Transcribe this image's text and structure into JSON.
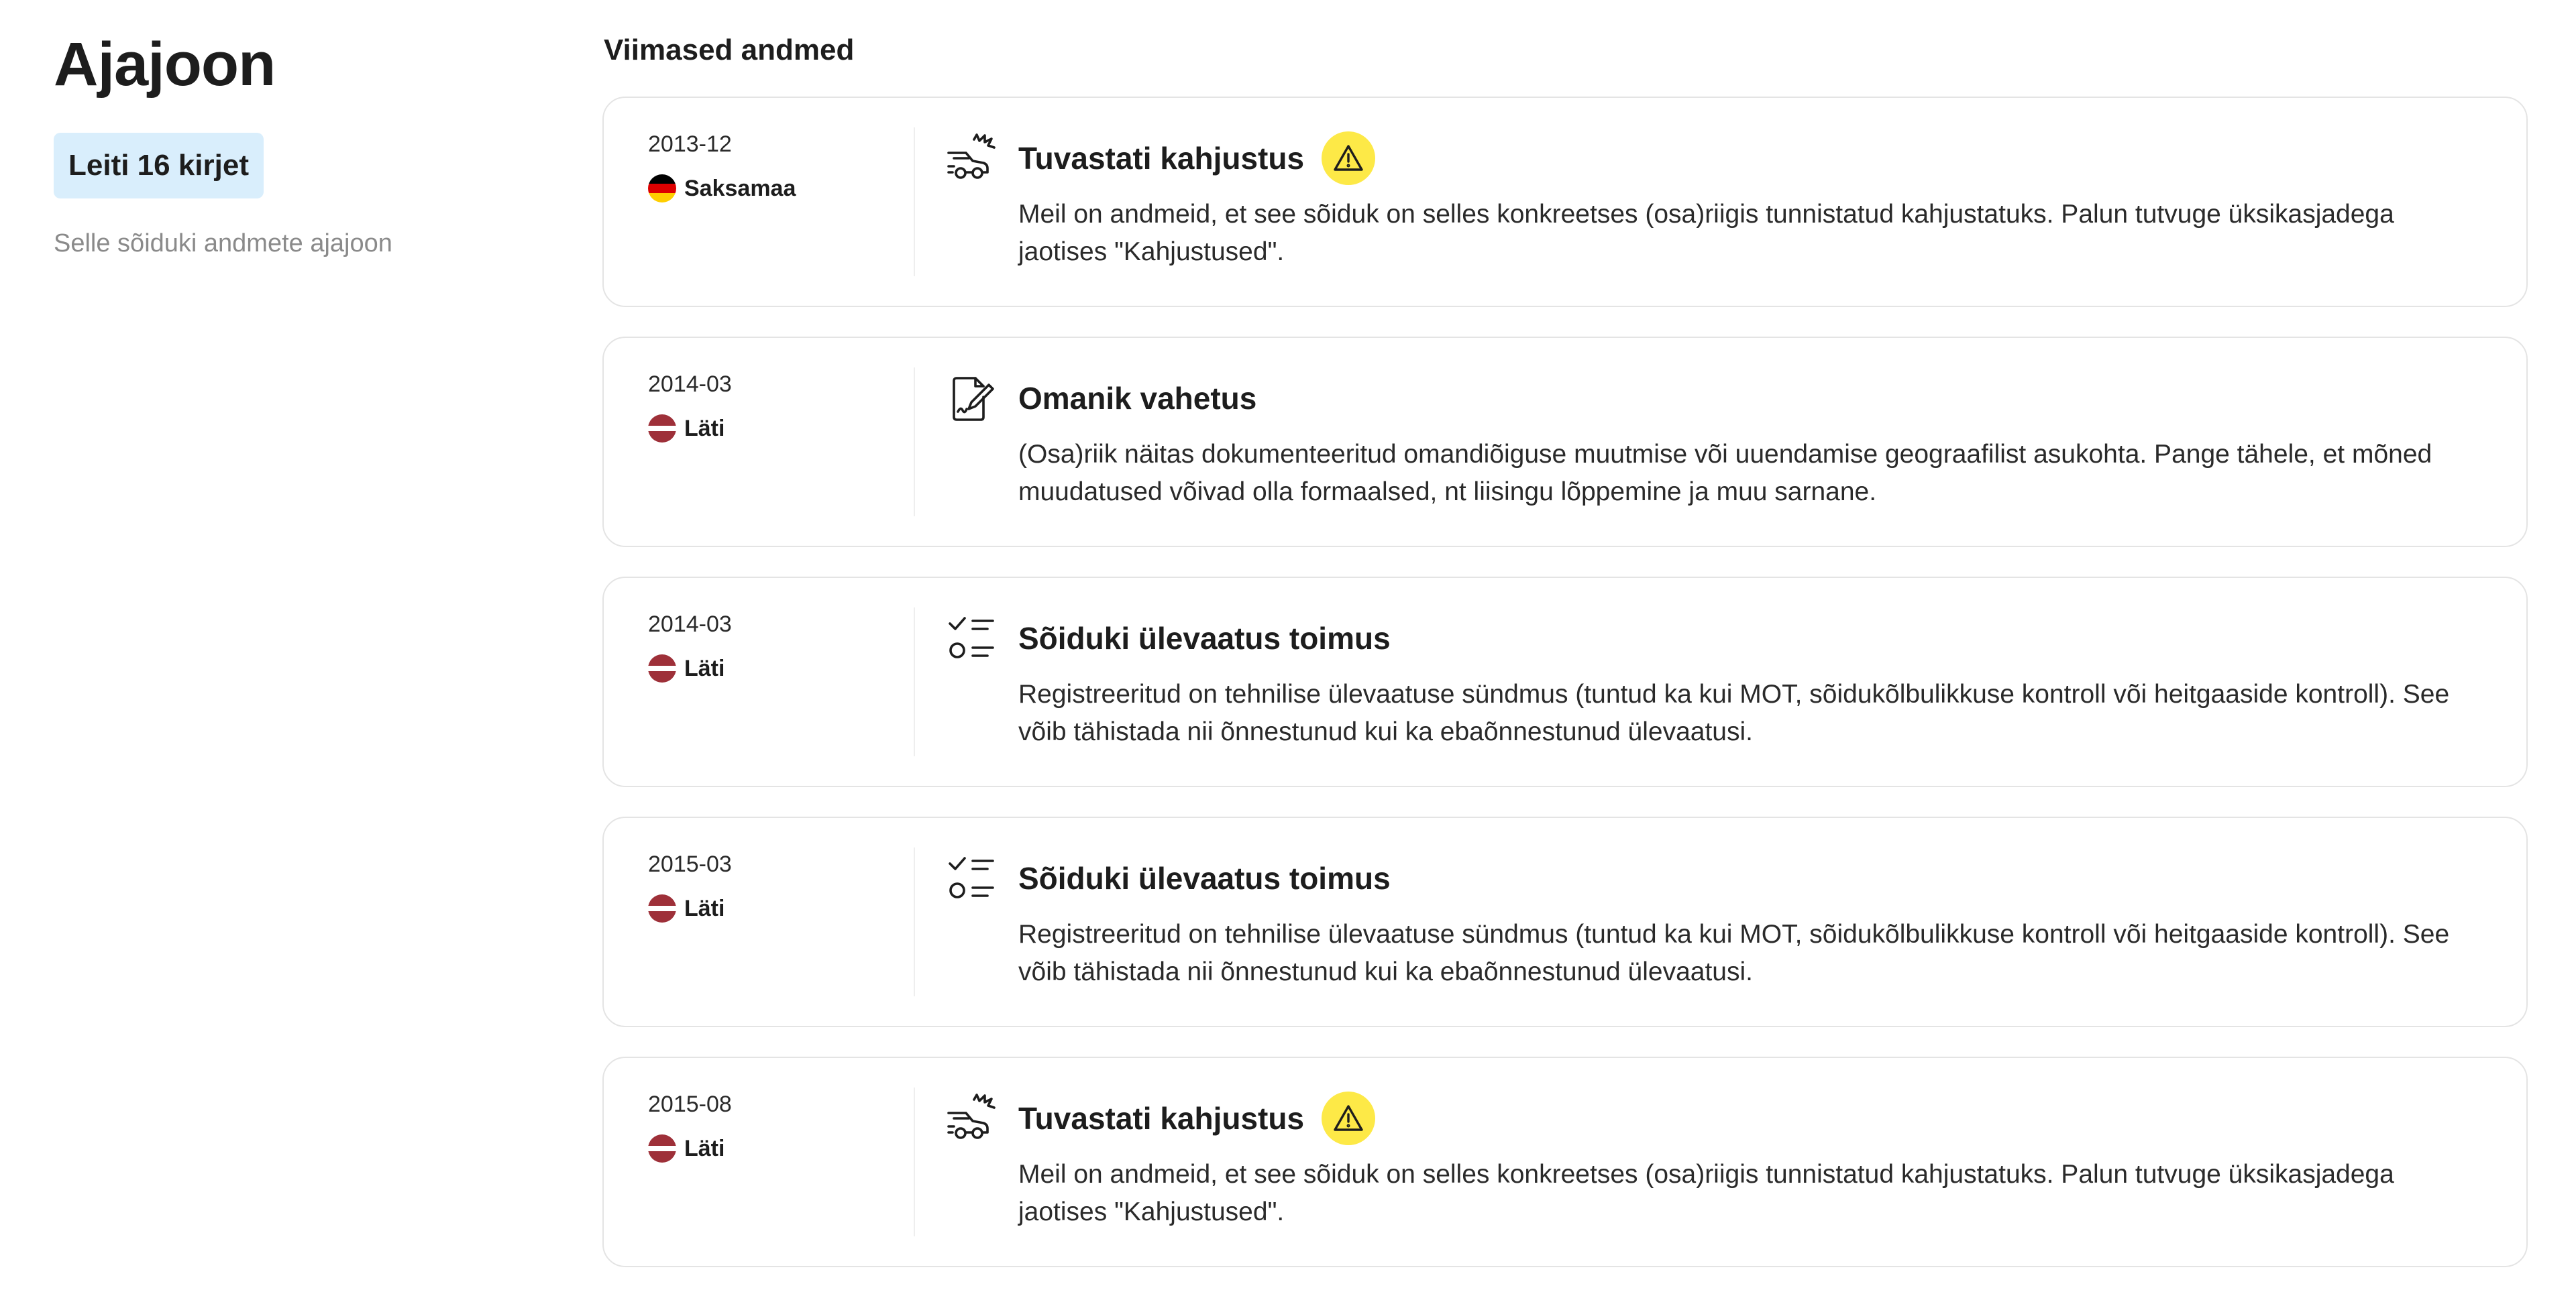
{
  "sidebar": {
    "title": "Ajajoon",
    "count_label": "Leiti 16 kirjet",
    "subtitle": "Selle sõiduki andmete ajajoon"
  },
  "main": {
    "section_title": "Viimased andmed",
    "events": [
      {
        "date": "2013-12",
        "country": "Saksamaa",
        "flag": "germany-flag",
        "icon": "car-damage-icon",
        "title": "Tuvastati kahjustus",
        "warning": true,
        "description": "Meil on andmeid, et see sõiduk on selles konkreetses (osa)riigis tunnistatud kahjustatuks. Palun tutvuge üksikasjadega jaotises \"Kahjustused\"."
      },
      {
        "date": "2014-03",
        "country": "Läti",
        "flag": "latvia-flag",
        "icon": "document-signature-icon",
        "title": "Omanik vahetus",
        "warning": false,
        "description": "(Osa)riik näitas dokumenteeritud omandiõiguse muutmise või uuendamise geograafilist asukohta. Pange tähele, et mõned muudatused võivad olla formaalsed, nt liisingu lõppemine ja muu sarnane."
      },
      {
        "date": "2014-03",
        "country": "Läti",
        "flag": "latvia-flag",
        "icon": "checklist-icon",
        "title": "Sõiduki ülevaatus toimus",
        "warning": false,
        "description": "Registreeritud on tehnilise ülevaatuse sündmus (tuntud ka kui MOT, sõidukõlbulikkuse kontroll või heitgaaside kontroll). See võib tähistada nii õnnestunud kui ka ebaõnnestunud ülevaatusi."
      },
      {
        "date": "2015-03",
        "country": "Läti",
        "flag": "latvia-flag",
        "icon": "checklist-icon",
        "title": "Sõiduki ülevaatus toimus",
        "warning": false,
        "description": "Registreeritud on tehnilise ülevaatuse sündmus (tuntud ka kui MOT, sõidukõlbulikkuse kontroll või heitgaaside kontroll). See võib tähistada nii õnnestunud kui ka ebaõnnestunud ülevaatusi."
      },
      {
        "date": "2015-08",
        "country": "Läti",
        "flag": "latvia-flag",
        "icon": "car-damage-icon",
        "title": "Tuvastati kahjustus",
        "warning": true,
        "description": "Meil on andmeid, et see sõiduk on selles konkreetses (osa)riigis tunnistatud kahjustatuks. Palun tutvuge üksikasjadega jaotises \"Kahjustused\"."
      }
    ]
  },
  "colors": {
    "badge_background": "#d9eefc",
    "warning_yellow": "#fde947",
    "card_border": "#e4e4e4",
    "muted_text": "#8a8a8a"
  }
}
